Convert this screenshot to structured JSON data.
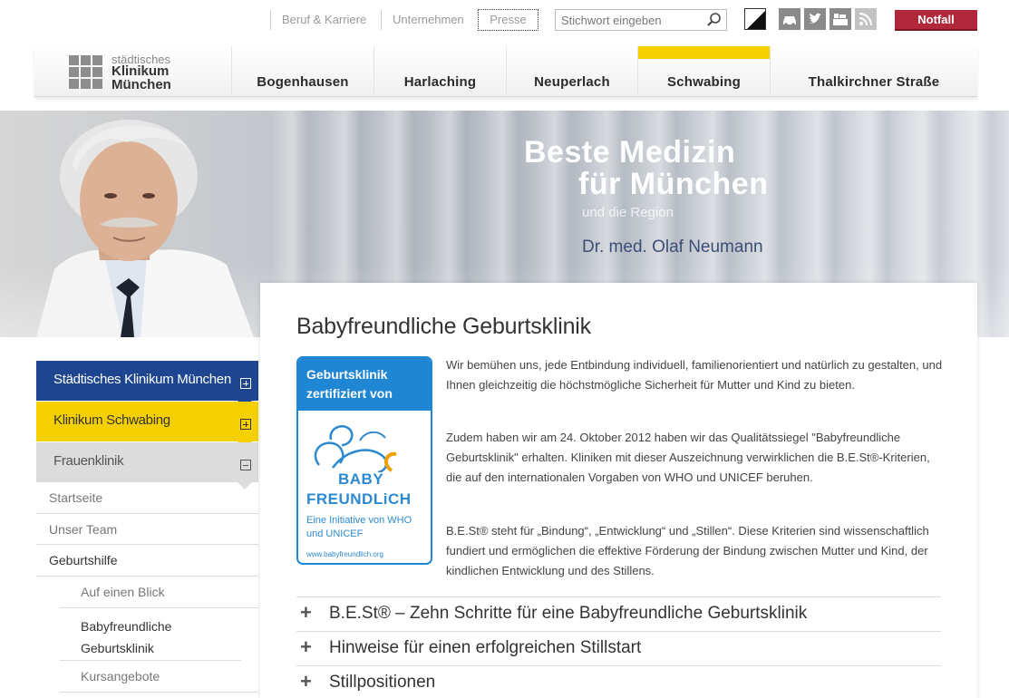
{
  "topbar": {
    "links": [
      "Beruf & Karriere",
      "Unternehmen"
    ],
    "presse": "Presse",
    "search_placeholder": "Stichwort eingeben",
    "notfall": "Notfall",
    "social_icons": [
      "contrast-icon",
      "car-icon",
      "twitter-icon",
      "video-icon",
      "rss-icon"
    ]
  },
  "logo": {
    "line1": "städtisches",
    "line2": "Klinikum",
    "line3": "München"
  },
  "nav": {
    "items": [
      "Bogenhausen",
      "Harlaching",
      "Neuperlach",
      "Schwabing",
      "Thalkirchner Straße"
    ],
    "active": "Schwabing"
  },
  "hero": {
    "line1": "Beste Medizin",
    "line2": "für München",
    "line3": "und die Region",
    "doctor": "Dr. med. Olaf Neumann"
  },
  "sidebar": {
    "level1": [
      "Städtisches Klinikum München",
      "Klinikum Schwabing",
      "Frauenklinik"
    ],
    "level2": [
      "Startseite",
      "Unser Team",
      "Geburtshilfe"
    ],
    "level3": [
      "Auf einen Blick",
      "Babyfreundliche Geburtsklinik",
      "Kursangebote"
    ]
  },
  "content": {
    "title": "Babyfreundliche Geburtsklinik",
    "badge": {
      "head1": "Geburtsklinik",
      "head2": "zertifiziert von",
      "word1": "BABY",
      "word2": "FREUNDLiCH",
      "sub1": "Eine Initiative von WHO",
      "sub2": "und UNICEF",
      "url": "www.babyfreundlich.org"
    },
    "paragraphs": [
      "Wir bemühen uns, jede Entbindung individuell, familienorientiert und natürlich zu gestalten, und Ihnen gleichzeitig die höchstmögliche Sicherheit für Mutter und Kind zu bieten.",
      "Zudem haben wir am 24. Oktober 2012 haben wir das Qualitätssiegel \"Babyfreundliche Geburtsklinik\" erhalten. Kliniken mit dieser Auszeichnung verwirklichen die B.E.St®-Kriterien, die auf den internationalen Vorgaben von WHO und UNICEF beruhen.",
      "B.E.St® steht für „Bindung“, „Entwicklung“ und „Stillen“. Diese Kriterien sind wissenschaftlich fundiert und ermöglichen die effektive Förderung der Bindung zwischen Mutter und Kind, der kindlichen Entwicklung und des Stillens."
    ],
    "accordion": [
      "B.E.St® – Zehn Schritte für eine Babyfreundliche Geburtsklinik",
      "Hinweise für einen erfolgreichen Stillstart",
      "Stillpositionen"
    ]
  },
  "colors": {
    "blue_nav": "#1e4690",
    "yellow_accent": "#f5d000",
    "grey_nav": "#dcdcdc",
    "notfall_red": "#b0283a",
    "badge_blue": "#1f86d3"
  }
}
